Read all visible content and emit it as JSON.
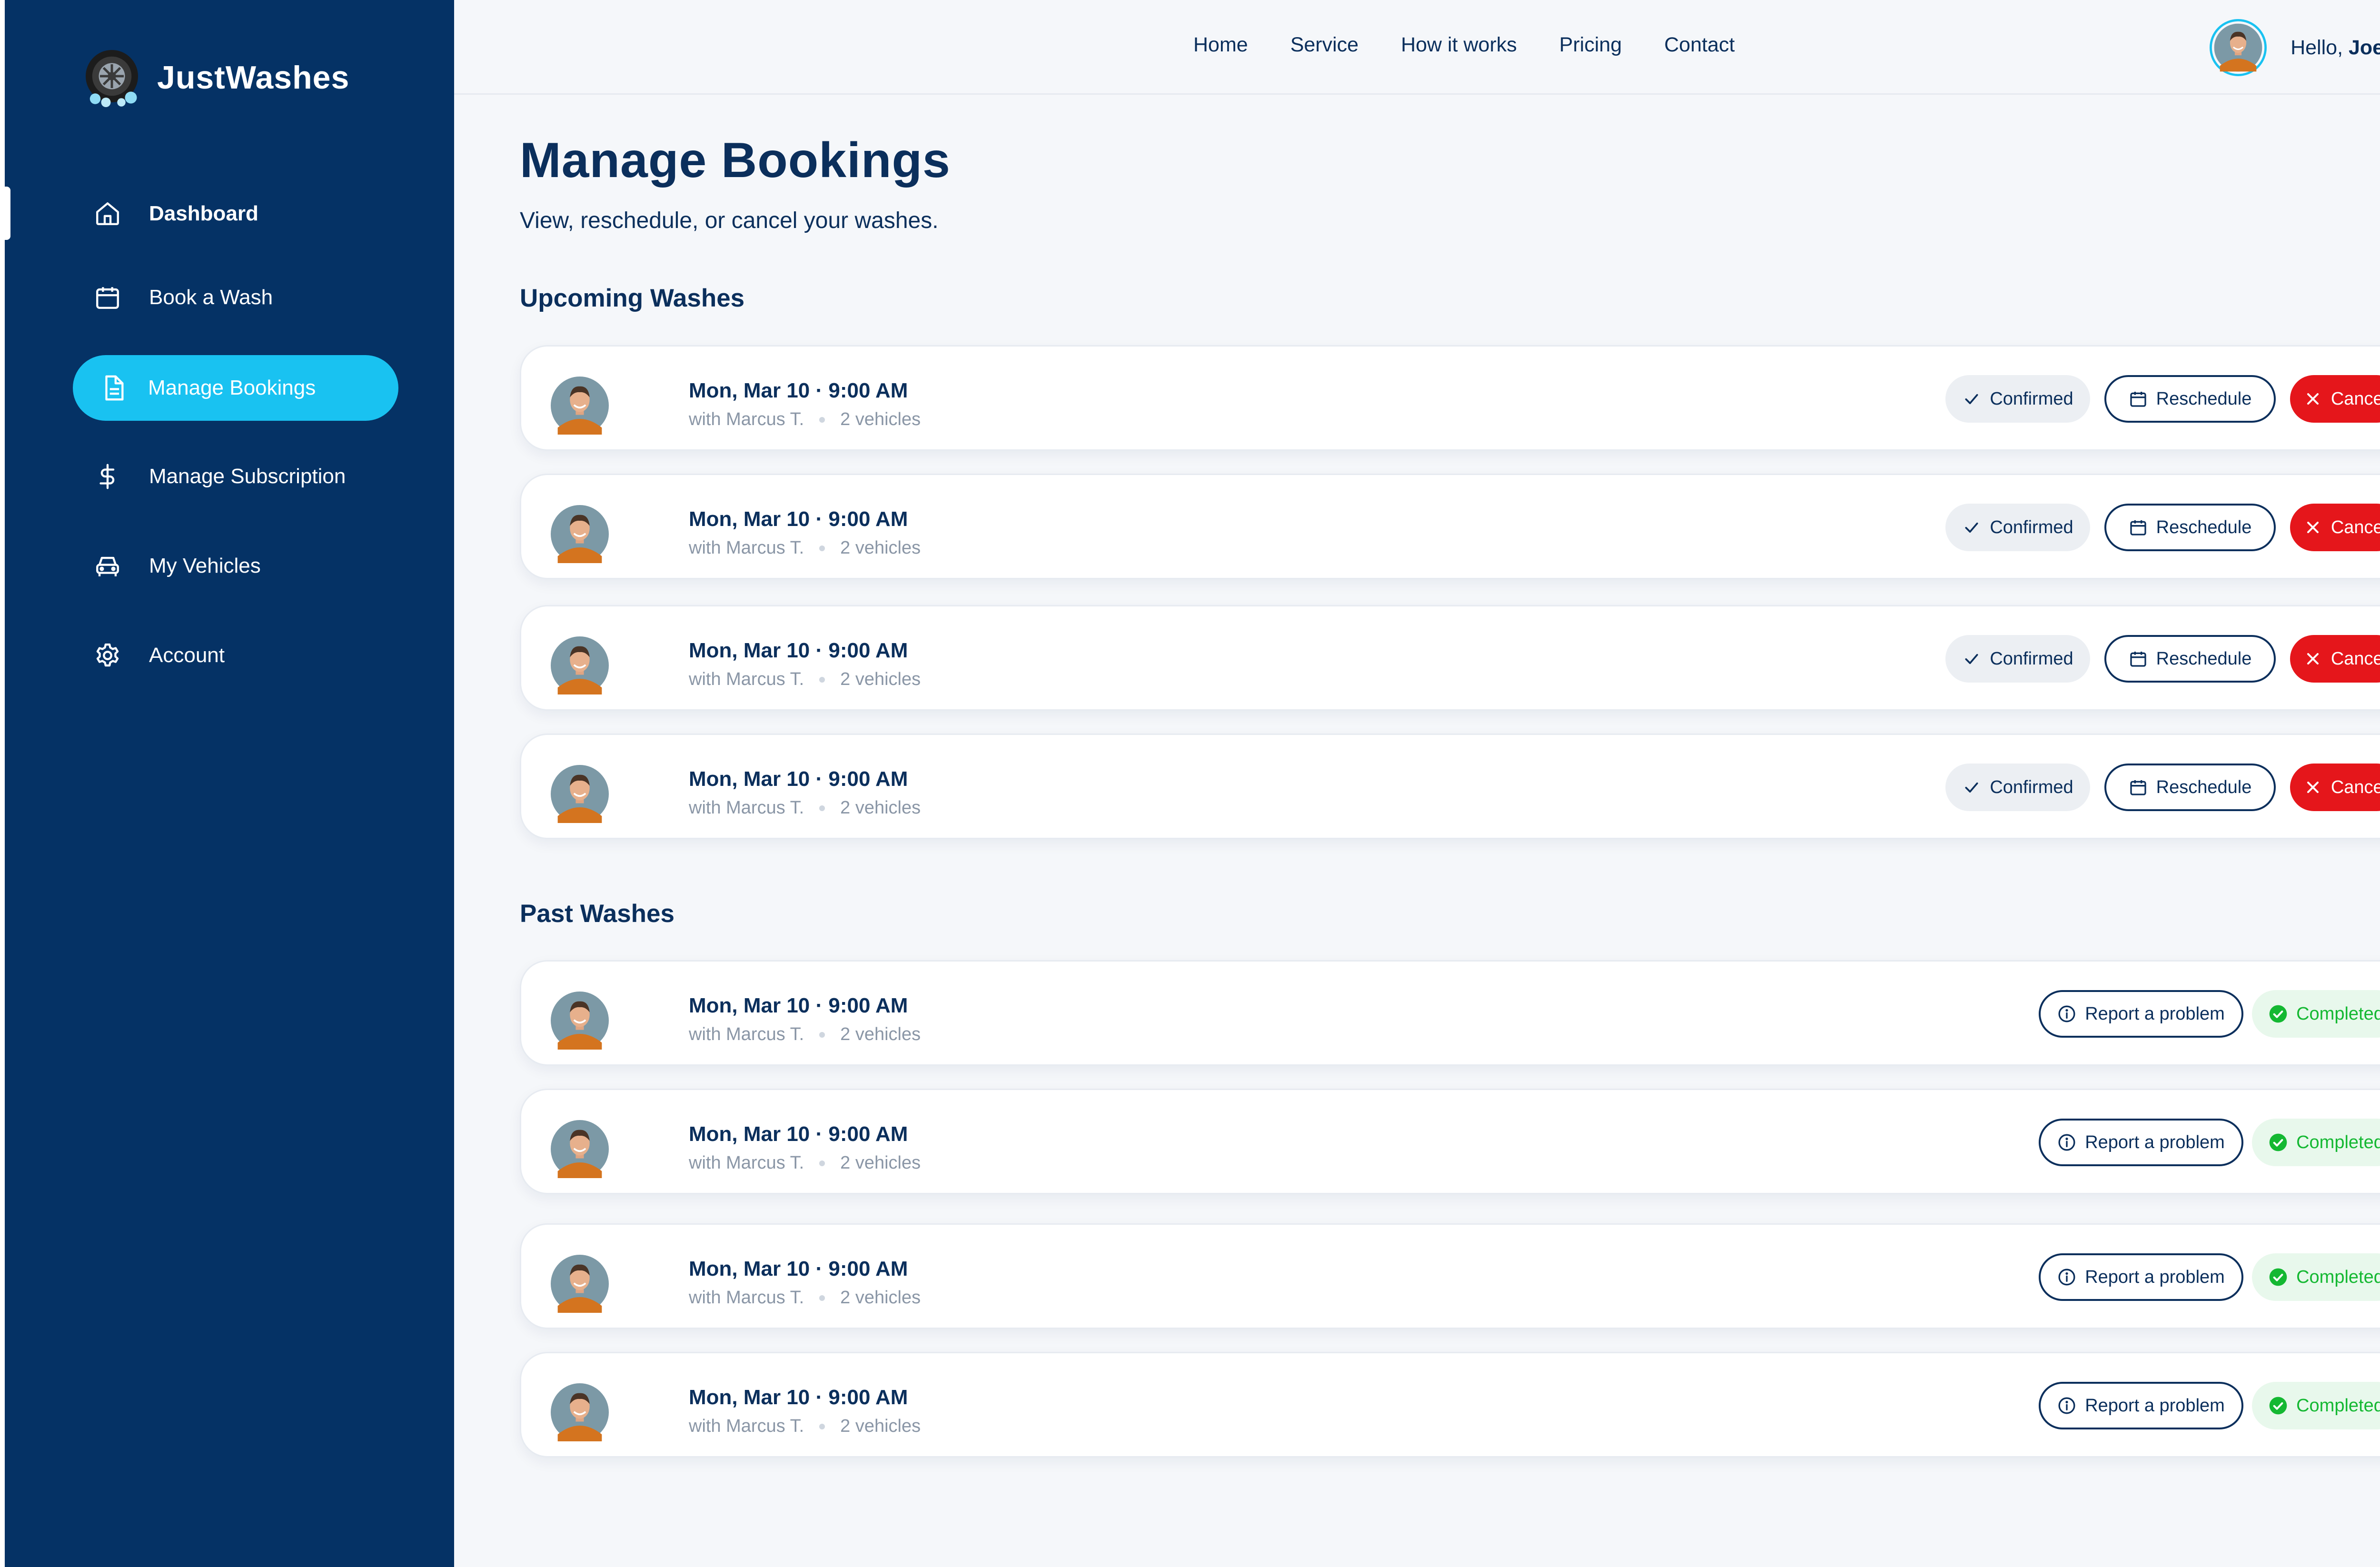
{
  "brand": {
    "name": "JustWashes"
  },
  "sidebar": {
    "items": [
      {
        "label": "Dashboard",
        "icon": "home-icon"
      },
      {
        "label": "Book a Wash",
        "icon": "calendar-icon"
      },
      {
        "label": "Manage Bookings",
        "icon": "document-icon",
        "active": true
      },
      {
        "label": "Manage Subscription",
        "icon": "dollar-icon"
      },
      {
        "label": "My Vehicles",
        "icon": "car-icon"
      },
      {
        "label": "Account",
        "icon": "gear-icon"
      }
    ]
  },
  "topnav": {
    "links": [
      "Home",
      "Service",
      "How it works",
      "Pricing",
      "Contact"
    ]
  },
  "user": {
    "greeting": "Hello,",
    "name": "Joey"
  },
  "page": {
    "title": "Manage Bookings",
    "subtitle": "View, reschedule, or cancel your washes."
  },
  "upcoming": {
    "title": "Upcoming Washes",
    "bookings": [
      {
        "date": "Mon, Mar 10 · 9:00 AM",
        "with": "with Marcus T.",
        "vehicles": "2 vehicles",
        "status": "Confirmed",
        "reschedule": "Reschedule",
        "cancel": "Cancel"
      },
      {
        "date": "Mon, Mar 10 · 9:00 AM",
        "with": "with Marcus T.",
        "vehicles": "2 vehicles",
        "status": "Confirmed",
        "reschedule": "Reschedule",
        "cancel": "Cancel"
      },
      {
        "date": "Mon, Mar 10 · 9:00 AM",
        "with": "with Marcus T.",
        "vehicles": "2 vehicles",
        "status": "Confirmed",
        "reschedule": "Reschedule",
        "cancel": "Cancel"
      },
      {
        "date": "Mon, Mar 10 · 9:00 AM",
        "with": "with Marcus T.",
        "vehicles": "2 vehicles",
        "status": "Confirmed",
        "reschedule": "Reschedule",
        "cancel": "Cancel"
      }
    ]
  },
  "past": {
    "title": "Past Washes",
    "bookings": [
      {
        "date": "Mon, Mar 10 · 9:00 AM",
        "with": "with Marcus T.",
        "vehicles": "2 vehicles",
        "report": "Report a problem",
        "status": "Completed"
      },
      {
        "date": "Mon, Mar 10 · 9:00 AM",
        "with": "with Marcus T.",
        "vehicles": "2 vehicles",
        "report": "Report a problem",
        "status": "Completed"
      },
      {
        "date": "Mon, Mar 10 · 9:00 AM",
        "with": "with Marcus T.",
        "vehicles": "2 vehicles",
        "report": "Report a problem",
        "status": "Completed"
      },
      {
        "date": "Mon, Mar 10 · 9:00 AM",
        "with": "with Marcus T.",
        "vehicles": "2 vehicles",
        "report": "Report a problem",
        "status": "Completed"
      }
    ]
  },
  "colors": {
    "sidebar_bg": "#053265",
    "active_item": "#19c2f1",
    "navy_text": "#0b2f5c",
    "cancel_red": "#e5161b",
    "completed_green": "#14b832",
    "page_bg": "#f5f7fa"
  }
}
